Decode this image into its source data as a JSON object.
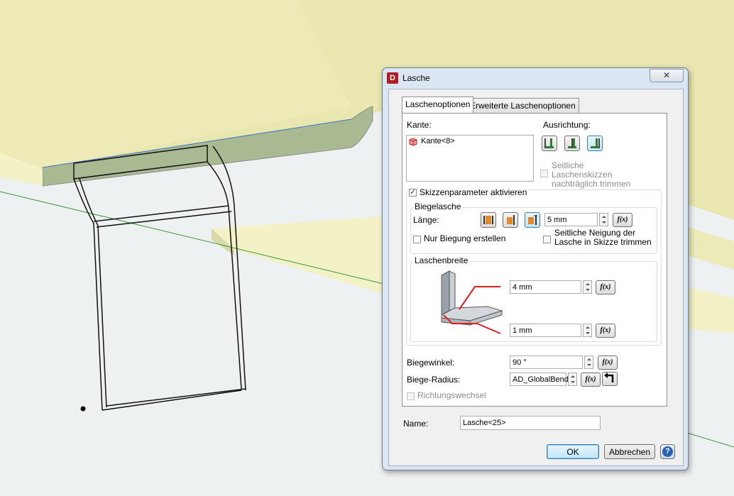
{
  "dialog": {
    "title": "Lasche",
    "app_icon_letter": "D",
    "close_glyph": "✕"
  },
  "tabs": [
    {
      "label": "Laschenoptionen",
      "active": true
    },
    {
      "label": "Erweiterte Laschenoptionen",
      "active": false
    }
  ],
  "kante": {
    "label": "Kante:",
    "items": [
      "Kante<8>"
    ]
  },
  "ausrichtung": {
    "label": "Ausrichtung:",
    "buttons": [
      "align-outside-icon",
      "align-middle-icon",
      "align-inside-icon"
    ],
    "selected_index": 2,
    "trim_checkbox_label": "Seitliche Laschenskizzen nachträglich trimmen",
    "trim_checkbox_checked": false,
    "trim_checkbox_enabled": false
  },
  "skizzenparameter": {
    "label": "Skizzenparameter aktivieren",
    "checked": true
  },
  "biegelasche": {
    "group_label": "Biegelasche",
    "laenge_label": "Länge:",
    "length_buttons": [
      "length-outer-icon",
      "length-inner-icon",
      "length-tangent-icon"
    ],
    "selected_index": 2,
    "laenge_value": "5 mm",
    "fx_label": "f(x)",
    "nur_biegung_label": "Nur Biegung erstellen",
    "nur_biegung_checked": false,
    "seitliche_neigung_label": "Seitliche Neigung der Lasche in Skizze trimmen",
    "seitliche_neigung_checked": false
  },
  "laschenbreite": {
    "group_label": "Laschenbreite",
    "value_top": "4 mm",
    "value_bottom": "1 mm"
  },
  "biegewinkel": {
    "label": "Biegewinkel:",
    "value": "90 °"
  },
  "biege_radius": {
    "label": "Biege-Radius:",
    "value": "AD_GlobalBend"
  },
  "richtungswechsel": {
    "label": "Richtungswechsel",
    "checked": false,
    "enabled": false
  },
  "name": {
    "label": "Name:",
    "value": "Lasche<25>"
  },
  "buttons": {
    "ok": "OK",
    "cancel": "Abbrechen",
    "help_glyph": "?"
  },
  "colors": {
    "sheet_face": "#f2f1c3",
    "sheet_edge": "#a3b58d",
    "viewport_bg": "#eef1f1",
    "dialog_frame": "#dbe6f3"
  }
}
